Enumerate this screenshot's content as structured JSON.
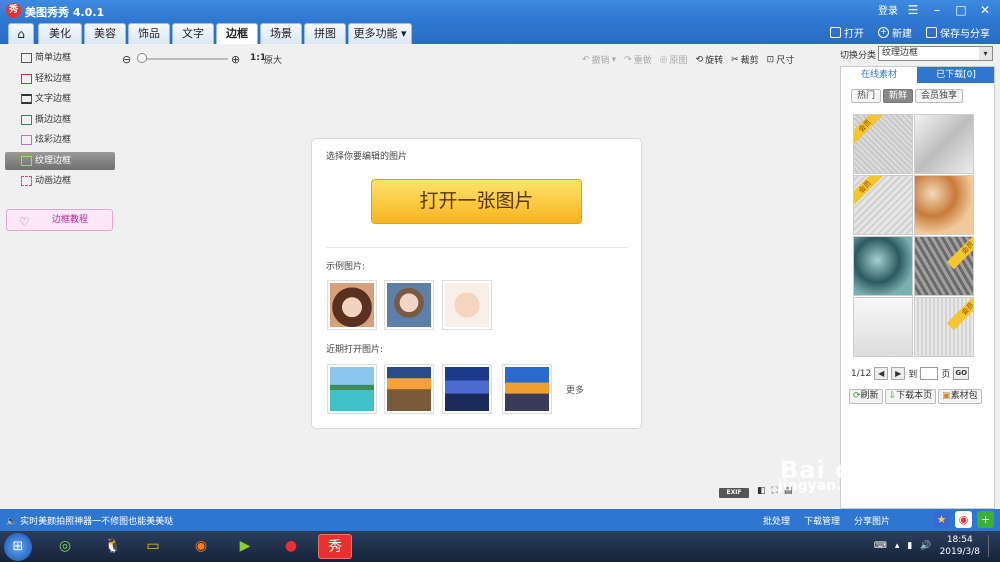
{
  "app": {
    "logo": "秀",
    "title": "美图秀秀 4.0.1",
    "login": "登录"
  },
  "tabs": [
    {
      "label": "⌂",
      "icon": "home-icon"
    },
    {
      "label": "美化"
    },
    {
      "label": "美容"
    },
    {
      "label": "饰品"
    },
    {
      "label": "文字"
    },
    {
      "label": "边框"
    },
    {
      "label": "场景"
    },
    {
      "label": "拼图"
    },
    {
      "label": "更多功能 ▾"
    }
  ],
  "top_actions": {
    "open": "打开",
    "new": "新建",
    "save_share": "保存与分享"
  },
  "sidebar": {
    "items": [
      {
        "label": "简单边框",
        "color": "#555555"
      },
      {
        "label": "轻松边框",
        "color": "#c0392b"
      },
      {
        "label": "文字边框",
        "color": "#333333"
      },
      {
        "label": "撕边边框",
        "color": "#2e8b57"
      },
      {
        "label": "炫彩边框",
        "color": "#c06ad8"
      },
      {
        "label": "纹理边框",
        "color": "#5aa02c"
      },
      {
        "label": "动画边框",
        "color": "#d04a7a"
      }
    ],
    "tutorial": "边框教程"
  },
  "zoom": {
    "ratio": "1:1",
    "original": "原大"
  },
  "toolbar": {
    "undo": "撤销",
    "redo": "重做",
    "original": "原图",
    "rotate": "旋转",
    "crop": "裁剪",
    "size": "尺寸"
  },
  "card": {
    "title": "选择你要编辑的图片",
    "open_button": "打开一张图片",
    "sample_label": "示例图片:",
    "recent_label": "近期打开图片:",
    "more": "更多"
  },
  "right_panel": {
    "category_label": "切换分类",
    "category_value": "纹理边框",
    "tab_online": "在线素材",
    "tab_downloaded": "已下载[0]",
    "subtabs": [
      "热门",
      "新鲜",
      "会员独享"
    ],
    "vip_badge": "会员",
    "page": "1/12",
    "to_label": "到",
    "page_unit": "页",
    "go": "GO",
    "refresh": "刷新",
    "download_page": "下载本页",
    "pack": "素材包"
  },
  "view": {
    "exif": "EXIF"
  },
  "status": {
    "text": "实时美颜拍照神器一不修图也能美美哒",
    "batch": "批处理",
    "download_mgr": "下载管理",
    "share_img": "分享图片"
  },
  "taskbar": {
    "time": "18:54",
    "date": "2019/3/8"
  },
  "watermark": {
    "brand": "Bai du 经验",
    "url": "jingyan.baidu.com"
  }
}
